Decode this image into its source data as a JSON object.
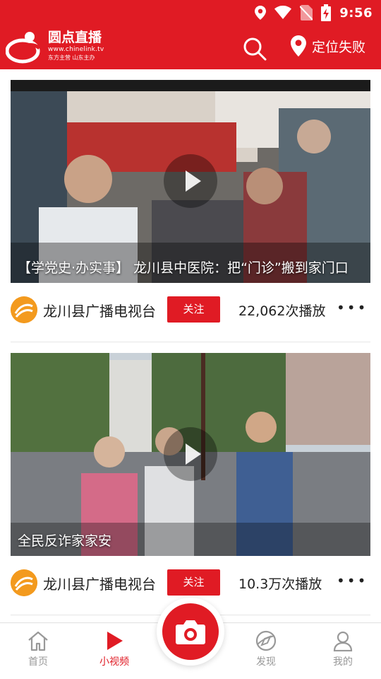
{
  "status_bar": {
    "time": "9:56",
    "icons": [
      "location-icon",
      "wifi-icon",
      "no-sim-icon",
      "battery-charging-icon"
    ]
  },
  "header": {
    "brand_name": "圆点直播",
    "brand_url": "www.chinelink.tv",
    "brand_sub": "东方主营  山东主办",
    "location_label": "定位失败"
  },
  "feed": {
    "items": [
      {
        "title": "【学党史·办实事】 龙川县中医院：把“门诊”搬到家门口",
        "channel": "龙川县广播电视台",
        "follow_label": "关注",
        "plays": "22,062次播放",
        "more": "•••"
      },
      {
        "title": "全民反诈家家安",
        "channel": "龙川县广播电视台",
        "follow_label": "关注",
        "plays": "10.3万次播放",
        "more": "•••"
      }
    ]
  },
  "tabbar": {
    "tabs": [
      {
        "label": "首页",
        "icon": "home-icon",
        "active": false
      },
      {
        "label": "小视频",
        "icon": "play-icon",
        "active": true
      },
      {
        "label": "发现",
        "icon": "compass-icon",
        "active": false
      },
      {
        "label": "我的",
        "icon": "user-icon",
        "active": false
      }
    ],
    "center_icon": "camera-icon"
  },
  "colors": {
    "accent": "#e01b24",
    "tab_inactive": "#999999"
  }
}
